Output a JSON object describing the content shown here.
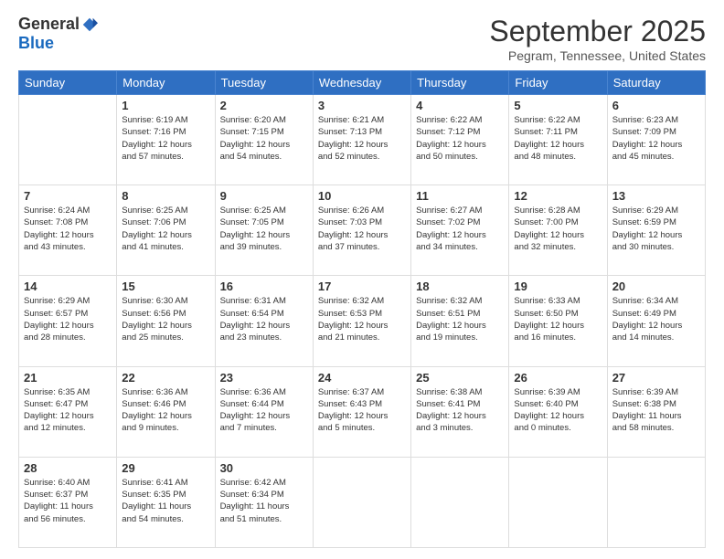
{
  "logo": {
    "general": "General",
    "blue": "Blue"
  },
  "title": "September 2025",
  "location": "Pegram, Tennessee, United States",
  "days_of_week": [
    "Sunday",
    "Monday",
    "Tuesday",
    "Wednesday",
    "Thursday",
    "Friday",
    "Saturday"
  ],
  "weeks": [
    [
      {
        "day": "",
        "info": ""
      },
      {
        "day": "1",
        "info": "Sunrise: 6:19 AM\nSunset: 7:16 PM\nDaylight: 12 hours\nand 57 minutes."
      },
      {
        "day": "2",
        "info": "Sunrise: 6:20 AM\nSunset: 7:15 PM\nDaylight: 12 hours\nand 54 minutes."
      },
      {
        "day": "3",
        "info": "Sunrise: 6:21 AM\nSunset: 7:13 PM\nDaylight: 12 hours\nand 52 minutes."
      },
      {
        "day": "4",
        "info": "Sunrise: 6:22 AM\nSunset: 7:12 PM\nDaylight: 12 hours\nand 50 minutes."
      },
      {
        "day": "5",
        "info": "Sunrise: 6:22 AM\nSunset: 7:11 PM\nDaylight: 12 hours\nand 48 minutes."
      },
      {
        "day": "6",
        "info": "Sunrise: 6:23 AM\nSunset: 7:09 PM\nDaylight: 12 hours\nand 45 minutes."
      }
    ],
    [
      {
        "day": "7",
        "info": "Sunrise: 6:24 AM\nSunset: 7:08 PM\nDaylight: 12 hours\nand 43 minutes."
      },
      {
        "day": "8",
        "info": "Sunrise: 6:25 AM\nSunset: 7:06 PM\nDaylight: 12 hours\nand 41 minutes."
      },
      {
        "day": "9",
        "info": "Sunrise: 6:25 AM\nSunset: 7:05 PM\nDaylight: 12 hours\nand 39 minutes."
      },
      {
        "day": "10",
        "info": "Sunrise: 6:26 AM\nSunset: 7:03 PM\nDaylight: 12 hours\nand 37 minutes."
      },
      {
        "day": "11",
        "info": "Sunrise: 6:27 AM\nSunset: 7:02 PM\nDaylight: 12 hours\nand 34 minutes."
      },
      {
        "day": "12",
        "info": "Sunrise: 6:28 AM\nSunset: 7:00 PM\nDaylight: 12 hours\nand 32 minutes."
      },
      {
        "day": "13",
        "info": "Sunrise: 6:29 AM\nSunset: 6:59 PM\nDaylight: 12 hours\nand 30 minutes."
      }
    ],
    [
      {
        "day": "14",
        "info": "Sunrise: 6:29 AM\nSunset: 6:57 PM\nDaylight: 12 hours\nand 28 minutes."
      },
      {
        "day": "15",
        "info": "Sunrise: 6:30 AM\nSunset: 6:56 PM\nDaylight: 12 hours\nand 25 minutes."
      },
      {
        "day": "16",
        "info": "Sunrise: 6:31 AM\nSunset: 6:54 PM\nDaylight: 12 hours\nand 23 minutes."
      },
      {
        "day": "17",
        "info": "Sunrise: 6:32 AM\nSunset: 6:53 PM\nDaylight: 12 hours\nand 21 minutes."
      },
      {
        "day": "18",
        "info": "Sunrise: 6:32 AM\nSunset: 6:51 PM\nDaylight: 12 hours\nand 19 minutes."
      },
      {
        "day": "19",
        "info": "Sunrise: 6:33 AM\nSunset: 6:50 PM\nDaylight: 12 hours\nand 16 minutes."
      },
      {
        "day": "20",
        "info": "Sunrise: 6:34 AM\nSunset: 6:49 PM\nDaylight: 12 hours\nand 14 minutes."
      }
    ],
    [
      {
        "day": "21",
        "info": "Sunrise: 6:35 AM\nSunset: 6:47 PM\nDaylight: 12 hours\nand 12 minutes."
      },
      {
        "day": "22",
        "info": "Sunrise: 6:36 AM\nSunset: 6:46 PM\nDaylight: 12 hours\nand 9 minutes."
      },
      {
        "day": "23",
        "info": "Sunrise: 6:36 AM\nSunset: 6:44 PM\nDaylight: 12 hours\nand 7 minutes."
      },
      {
        "day": "24",
        "info": "Sunrise: 6:37 AM\nSunset: 6:43 PM\nDaylight: 12 hours\nand 5 minutes."
      },
      {
        "day": "25",
        "info": "Sunrise: 6:38 AM\nSunset: 6:41 PM\nDaylight: 12 hours\nand 3 minutes."
      },
      {
        "day": "26",
        "info": "Sunrise: 6:39 AM\nSunset: 6:40 PM\nDaylight: 12 hours\nand 0 minutes."
      },
      {
        "day": "27",
        "info": "Sunrise: 6:39 AM\nSunset: 6:38 PM\nDaylight: 11 hours\nand 58 minutes."
      }
    ],
    [
      {
        "day": "28",
        "info": "Sunrise: 6:40 AM\nSunset: 6:37 PM\nDaylight: 11 hours\nand 56 minutes."
      },
      {
        "day": "29",
        "info": "Sunrise: 6:41 AM\nSunset: 6:35 PM\nDaylight: 11 hours\nand 54 minutes."
      },
      {
        "day": "30",
        "info": "Sunrise: 6:42 AM\nSunset: 6:34 PM\nDaylight: 11 hours\nand 51 minutes."
      },
      {
        "day": "",
        "info": ""
      },
      {
        "day": "",
        "info": ""
      },
      {
        "day": "",
        "info": ""
      },
      {
        "day": "",
        "info": ""
      }
    ]
  ]
}
